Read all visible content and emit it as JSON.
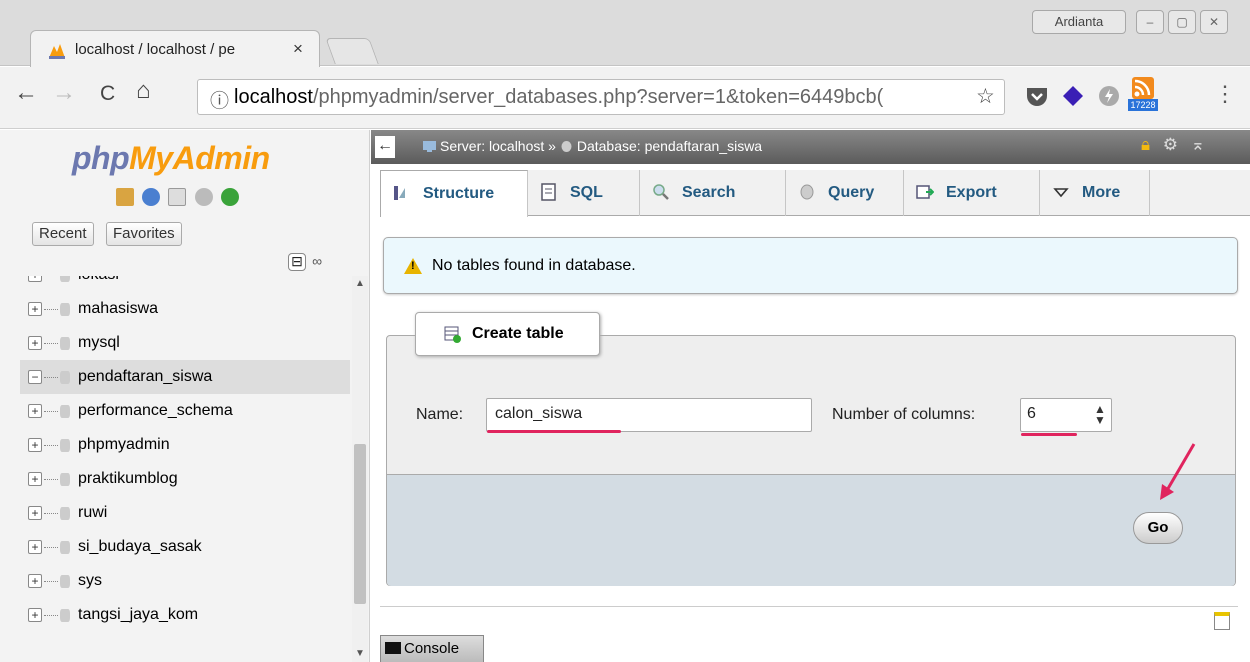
{
  "browser": {
    "tab_title": "localhost / localhost / pe",
    "tab_close": "×",
    "user_name": "Ardianta",
    "window_controls": [
      "–",
      "▢",
      "✕"
    ],
    "nav": {
      "back": "←",
      "forward": "→",
      "reload": "C",
      "home": "⌂"
    },
    "address_info": "ⓘ",
    "address_host": "localhost",
    "address_path": "/phpmyadmin/server_databases.php?server=1&token=6449bcb(",
    "bookmark_star": "☆",
    "rss_count": "17228",
    "menu": "⋮",
    "colors": {
      "accent": "#ffffff",
      "tab_bg": "#f2f2f2",
      "titlebar": "#dcdcdc"
    }
  },
  "sidebar": {
    "logo_php": "php",
    "logo_my": "My",
    "logo_admin": "Admin",
    "logo_icons": [
      "home-icon",
      "help-icon",
      "docs-icon",
      "settings-icon",
      "reload-icon"
    ],
    "tabs": [
      "Recent",
      "Favorites"
    ],
    "collapse_all": "⊟",
    "link_icon": "∞",
    "databases": [
      {
        "name": "lokasi",
        "expander": "+",
        "selected": false
      },
      {
        "name": "mahasiswa",
        "expander": "+",
        "selected": false
      },
      {
        "name": "mysql",
        "expander": "+",
        "selected": false
      },
      {
        "name": "pendaftaran_siswa",
        "expander": "−",
        "selected": true
      },
      {
        "name": "performance_schema",
        "expander": "+",
        "selected": false
      },
      {
        "name": "phpmyadmin",
        "expander": "+",
        "selected": false
      },
      {
        "name": "praktikumblog",
        "expander": "+",
        "selected": false
      },
      {
        "name": "ruwi",
        "expander": "+",
        "selected": false
      },
      {
        "name": "si_budaya_sasak",
        "expander": "+",
        "selected": false
      },
      {
        "name": "sys",
        "expander": "+",
        "selected": false
      },
      {
        "name": "tangsi_jaya_kom",
        "expander": "+",
        "selected": false
      }
    ],
    "scroll_up": "▲",
    "scroll_down": "▼"
  },
  "topbar": {
    "back": "←",
    "server": "Server: localhost",
    "separator": "»",
    "database": "Database: pendaftaran_siswa",
    "icons": [
      "lock-icon",
      "gear-icon",
      "collapse-icon"
    ]
  },
  "tabs": [
    {
      "label": "Structure",
      "icon": "structure-icon",
      "active": true
    },
    {
      "label": "SQL",
      "icon": "sql-icon",
      "active": false
    },
    {
      "label": "Search",
      "icon": "search-icon",
      "active": false
    },
    {
      "label": "Query",
      "icon": "query-icon",
      "active": false
    },
    {
      "label": "Export",
      "icon": "export-icon",
      "active": false
    },
    {
      "label": "More",
      "icon": "caret-down-icon",
      "active": false
    }
  ],
  "notice": {
    "message": "No tables found in database.",
    "icon": "warning-icon"
  },
  "create_table": {
    "legend": "Create table",
    "name_label": "Name:",
    "name_value": "calon_siswa",
    "columns_label": "Number of columns:",
    "columns_value": "6",
    "go_label": "Go"
  },
  "console": {
    "label": "Console"
  },
  "annotation_color": "#e0245e"
}
